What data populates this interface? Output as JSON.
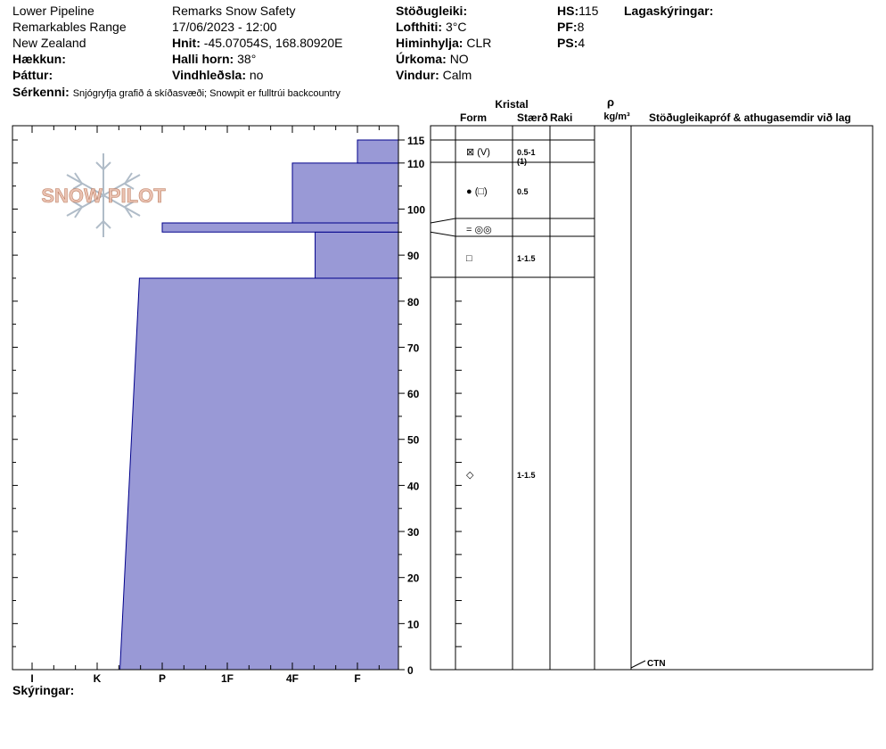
{
  "header": {
    "location": "Lower Pipeline",
    "range": "Remarkables Range",
    "country": "New Zealand",
    "elevation_label": "Hækkun:",
    "aspect_label": "Þáttur:",
    "features_label": "Sérkenni:",
    "features_value": "Snjógryfja grafið á skíðasvæði;  Snowpit er fulltrúi backcountry",
    "observer": "Remarks Snow Safety",
    "datetime": "17/06/2023 - 12:00",
    "coords_label": "Hnit:",
    "coords_value": "-45.07054S, 168.80920E",
    "slope_label": "Halli horn:",
    "slope_value": "38°",
    "wind_loading_label": "Vindhleðsla:",
    "wind_loading_value": "no",
    "stability_label": "Stöðugleiki:",
    "air_temp_label": "Lofthiti:",
    "air_temp_value": "3°C",
    "sky_label": "Himinhylja:",
    "sky_value": "CLR",
    "precip_label": "Úrkoma:",
    "precip_value": "NO",
    "wind_label": "Vindur:",
    "wind_value": "Calm",
    "hs_label": "HS:",
    "hs_value": "115",
    "pf_label": "PF:",
    "pf_value": "8",
    "ps_label": "PS:",
    "ps_value": "4",
    "layer_notes_label": "Lagaskýringar:",
    "notes_label": "Skýringar:"
  },
  "logo_text": "SNOW PILOT",
  "columns": {
    "kristal": "Kristal",
    "form": "Form",
    "size": "Stærð",
    "moisture": "Raki",
    "rho": "ρ",
    "density_unit": "kg/m³",
    "tests": "Stöðugleikapróf & athugasemdir við lag"
  },
  "chart_data": {
    "type": "area",
    "xlabel": "",
    "ylabel": "",
    "x_categories": [
      "I",
      "K",
      "P",
      "1F",
      "4F",
      "F"
    ],
    "ylim": [
      0,
      115
    ],
    "y_ticks": [
      0,
      10,
      20,
      30,
      40,
      50,
      60,
      70,
      80,
      90,
      100,
      110,
      115
    ],
    "hardness_index_note": "hardness on category index scale (I=0, K=1, P=2, 1F=3, 4F=4, F=5)",
    "layers": [
      {
        "bottom": 0,
        "top": 85,
        "hardness_bottom": 1.35,
        "hardness_top": 1.65,
        "form": "◇",
        "size": "1-1.5"
      },
      {
        "bottom": 85,
        "top": 95,
        "hardness_bottom": 4.35,
        "hardness_top": 4.35,
        "form": "□",
        "size": "1-1.5"
      },
      {
        "bottom": 95,
        "top": 97,
        "hardness_bottom": 2.0,
        "hardness_top": 2.0,
        "form": "= ◎◎",
        "size": ""
      },
      {
        "bottom": 97,
        "top": 110,
        "hardness_bottom": 4.0,
        "hardness_top": 4.0,
        "form": "● (□)",
        "size": "0.5"
      },
      {
        "bottom": 110,
        "top": 115,
        "hardness_bottom": 5.0,
        "hardness_top": 5.0,
        "form": "⊠ (V)",
        "size": "0.5-1 (1)"
      }
    ],
    "annotation": "CTN"
  },
  "colors": {
    "fill": "#9999d6",
    "stroke": "#00008b",
    "logo": "#e8b9a6"
  }
}
